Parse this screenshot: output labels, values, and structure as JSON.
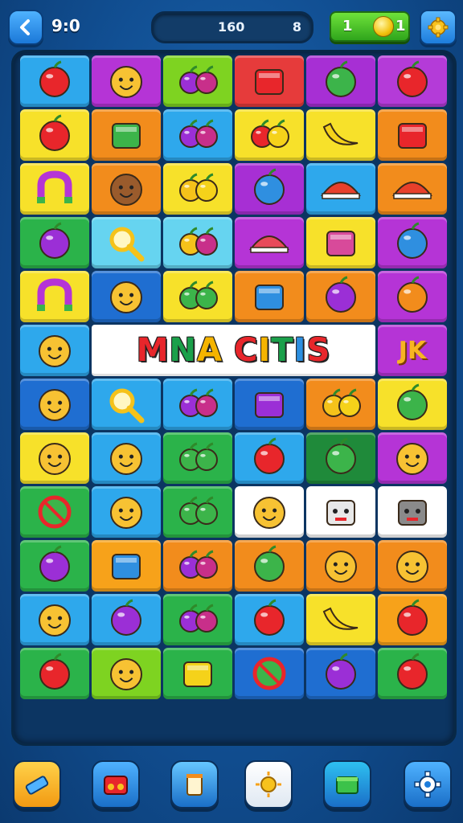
{
  "topbar": {
    "timer": "9:0",
    "score": "160",
    "score_target": "8",
    "coins": "1",
    "coins_suffix": "1",
    "back_icon": "chevron-left-icon",
    "settings_icon": "gear-icon"
  },
  "board": {
    "banner_text": [
      "M",
      "N",
      "A",
      " ",
      "C",
      "I",
      "T",
      "I",
      "S"
    ],
    "banner_colors": [
      "#e8262b",
      "#1aa04a",
      "#f5b400",
      "#ffffff",
      "#e8262b",
      "#f5b400",
      "#1aa04a",
      "#2c8fe0",
      "#e8262b"
    ],
    "side_label": "JK",
    "rows": [
      [
        {
          "bg": "#2ea8ec",
          "icon": "flower-icon"
        },
        {
          "bg": "#b534d6",
          "icon": "sun-face-icon"
        },
        {
          "bg": "#7ed321",
          "icon": "grapes-heart-icon"
        },
        {
          "bg": "#e63b3b",
          "icon": "soda-cans-icon"
        },
        {
          "bg": "#a72fd4",
          "icon": "leaf-icon"
        },
        {
          "bg": "#b43bd8",
          "icon": "tomato-icon"
        }
      ],
      [
        {
          "bg": "#f7e12a",
          "icon": "apple-icon"
        },
        {
          "bg": "#f28c1c",
          "icon": "popsicle-icon"
        },
        {
          "bg": "#2ea8ec",
          "icon": "berry-banana-icon"
        },
        {
          "bg": "#f7e12a",
          "icon": "lollipop-box-icon"
        },
        {
          "bg": "#f7e12a",
          "icon": "banana-icon"
        },
        {
          "bg": "#f28c1c",
          "icon": "heart-box-icon"
        }
      ],
      [
        {
          "bg": "#f7e12a",
          "icon": "magnet-icon"
        },
        {
          "bg": "#f28c1c",
          "icon": "bear-icon"
        },
        {
          "bg": "#f7e12a",
          "icon": "two-lemons-icon"
        },
        {
          "bg": "#a72fd4",
          "icon": "balloon-icon"
        },
        {
          "bg": "#2ea8ec",
          "icon": "hat-icon"
        },
        {
          "bg": "#f28c1c",
          "icon": "umbrella-icon"
        }
      ],
      [
        {
          "bg": "#2bb34a",
          "icon": "purple-ball-icon"
        },
        {
          "bg": "#66d4f0",
          "icon": "magnifier-icon"
        },
        {
          "bg": "#66d4f0",
          "icon": "lemon-berry-icon"
        },
        {
          "bg": "#b534d6",
          "icon": "lips-icon"
        },
        {
          "bg": "#f7e12a",
          "icon": "crossed-tools-icon"
        },
        {
          "bg": "#b534d6",
          "icon": "blue-orb-icon"
        }
      ],
      [
        {
          "bg": "#f7e12a",
          "icon": "horseshoe-icon"
        },
        {
          "bg": "#1f6ed1",
          "icon": "cheese-icon"
        },
        {
          "bg": "#f7e12a",
          "icon": "apple-broccoli-icon"
        },
        {
          "bg": "#f28c1c",
          "icon": "candy-icon"
        },
        {
          "bg": "#f28c1c",
          "icon": "grape-hook-icon"
        },
        {
          "bg": "#b534d6",
          "icon": "orange-icon"
        }
      ],
      [
        {
          "bg": "#2ea8ec",
          "icon": "orange-face-icon"
        },
        {
          "banner": true
        },
        {
          "bg": "#b534d6",
          "icon": "jk-label"
        }
      ],
      [
        {
          "bg": "#1f6ed1",
          "icon": "cat-face-icon"
        },
        {
          "bg": "#2ea8ec",
          "icon": "magnifier-icon"
        },
        {
          "bg": "#2ea8ec",
          "icon": "broccoli-berry-icon"
        },
        {
          "bg": "#1f6ed1",
          "icon": "gift-box-icon"
        },
        {
          "bg": "#f28c1c",
          "icon": "bone-lemon-icon"
        },
        {
          "bg": "#f7e12a",
          "icon": "green-cactus-icon"
        }
      ],
      [
        {
          "bg": "#f7e12a",
          "icon": "heart-face-icon"
        },
        {
          "bg": "#2ea8ec",
          "icon": "gear-sun-icon"
        },
        {
          "bg": "#2bb34a",
          "icon": "popsicle-carrot-icon"
        },
        {
          "bg": "#2ea8ec",
          "icon": "apple-icon"
        },
        {
          "bg": "#1f8a3a",
          "icon": "green-leaf-icon"
        },
        {
          "bg": "#b534d6",
          "icon": "cheese-wedge-icon"
        }
      ],
      [
        {
          "bg": "#2bb34a",
          "icon": "no-sign-icon"
        },
        {
          "bg": "#2ea8ec",
          "icon": "toaster-icon"
        },
        {
          "bg": "#2bb34a",
          "icon": "tomato-broccoli-icon"
        },
        {
          "bg": "#ffffff",
          "icon": "sunflower-icon"
        },
        {
          "bg": "#ffffff",
          "icon": "robot-icon"
        },
        {
          "bg": "#ffffff",
          "icon": "gray-robot-icon"
        }
      ],
      [
        {
          "bg": "#2bb34a",
          "icon": "kettlebell-icon"
        },
        {
          "bg": "#f7a21a",
          "icon": "crayon-box-icon"
        },
        {
          "bg": "#f28c1c",
          "icon": "grape-stick-icon"
        },
        {
          "bg": "#f28c1c",
          "icon": "lime-icon"
        },
        {
          "bg": "#f28c1c",
          "icon": "star-face-icon"
        },
        {
          "bg": "#f28c1c",
          "icon": "cat-face-icon"
        }
      ],
      [
        {
          "bg": "#2ea8ec",
          "icon": "monkey-face-icon"
        },
        {
          "bg": "#2ea8ec",
          "icon": "flask-icon"
        },
        {
          "bg": "#2bb34a",
          "icon": "orange-berry-icon"
        },
        {
          "bg": "#2ea8ec",
          "icon": "red-heart-apple-icon"
        },
        {
          "bg": "#f7e12a",
          "icon": "banana-icon"
        },
        {
          "bg": "#f7a21a",
          "icon": "bone-icon"
        }
      ],
      [
        {
          "bg": "#2bb34a",
          "icon": "striped-apple-icon"
        },
        {
          "bg": "#7ed321",
          "icon": "teddy-face-icon"
        },
        {
          "bg": "#2bb34a",
          "icon": "soap-bars-icon"
        },
        {
          "bg": "#1f6ed1",
          "icon": "target-icon"
        },
        {
          "bg": "#1f6ed1",
          "icon": "potions-icon"
        },
        {
          "bg": "#2bb34a",
          "icon": "apple-icon"
        }
      ]
    ]
  },
  "bottombar": {
    "buttons": [
      {
        "name": "eraser-button",
        "icon": "eraser-icon",
        "color": "#f7b522"
      },
      {
        "name": "radio-button",
        "icon": "radio-icon",
        "color": "#4fb2ff"
      },
      {
        "name": "jar-button",
        "icon": "jar-icon",
        "color": "#66c6ff"
      },
      {
        "name": "sun-button",
        "icon": "sun-icon",
        "color": "#ffffff"
      },
      {
        "name": "box-button",
        "icon": "green-box-icon",
        "color": "#2ec0f0"
      },
      {
        "name": "settings-button",
        "icon": "gear-icon",
        "color": "#4fb2ff"
      }
    ]
  }
}
